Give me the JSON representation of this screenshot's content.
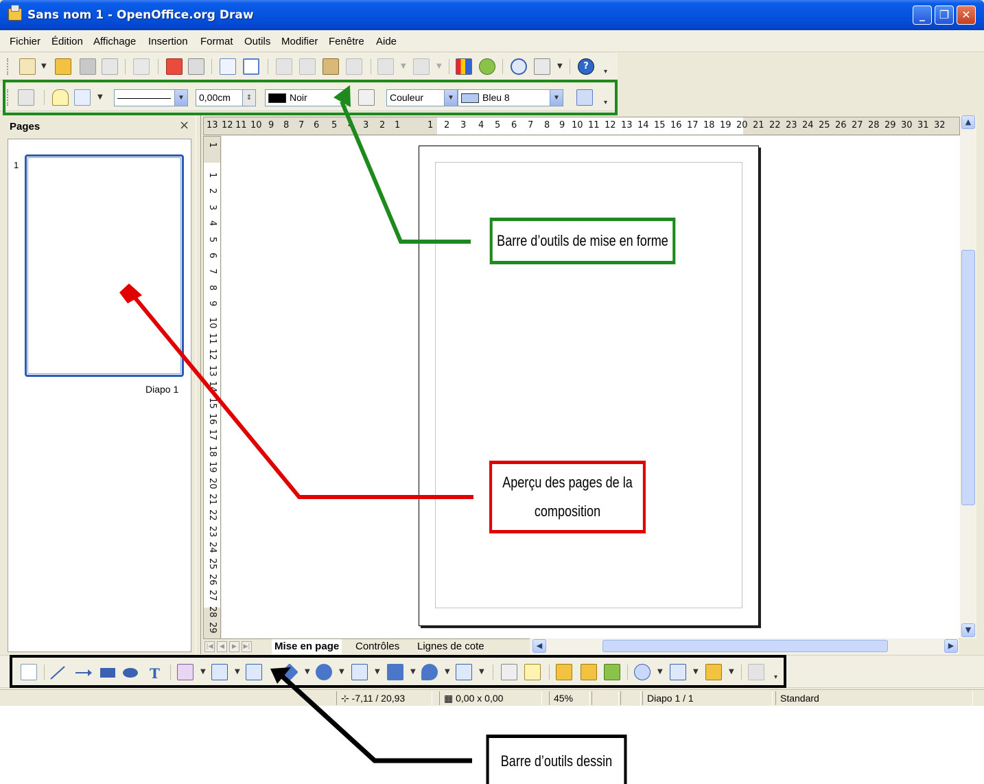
{
  "window": {
    "title": "Sans nom 1 - OpenOffice.org Draw"
  },
  "menu": [
    "Fichier",
    "Édition",
    "Affichage",
    "Insertion",
    "Format",
    "Outils",
    "Modifier",
    "Fenêtre",
    "Aide"
  ],
  "format_toolbar": {
    "line_style": "",
    "line_width": "0,00cm",
    "line_color": {
      "label": "Noir",
      "swatch": "#000000"
    },
    "area_style": "Couleur",
    "area_fill": {
      "label": "Bleu 8",
      "swatch": "#b2cbf0"
    }
  },
  "pages_panel": {
    "title": "Pages",
    "close": "×",
    "items": [
      {
        "number": "1",
        "label": "Diapo 1"
      }
    ]
  },
  "hruler_labels": [
    "13",
    "12",
    "11",
    "10",
    "9",
    "8",
    "7",
    "6",
    "5",
    "4",
    "3",
    "2",
    "1",
    "1",
    "2",
    "3",
    "4",
    "5",
    "6",
    "7",
    "8",
    "9",
    "10",
    "11",
    "12",
    "13",
    "14",
    "15",
    "16",
    "17",
    "18",
    "19",
    "20",
    "21",
    "22",
    "23",
    "24",
    "25",
    "26",
    "27",
    "28",
    "29",
    "30",
    "31",
    "32"
  ],
  "vruler_labels": [
    "1",
    "1",
    "2",
    "3",
    "4",
    "5",
    "6",
    "7",
    "8",
    "9",
    "10",
    "11",
    "12",
    "13",
    "14",
    "15",
    "16",
    "17",
    "18",
    "19",
    "20",
    "21",
    "22",
    "23",
    "24",
    "25",
    "26",
    "27",
    "28",
    "29"
  ],
  "tabs": [
    "Mise en page",
    "Contrôles",
    "Lignes de cote"
  ],
  "status": {
    "position": "-7,11 / 20,93",
    "size": "0,00 x 0,00",
    "zoom": "45%",
    "slide": "Diapo 1 / 1",
    "layout": "Standard"
  },
  "callouts": {
    "format_toolbar": "Barre d’outils de mise en forme",
    "pages_preview": "Aperçu des pages de la composition",
    "drawing_toolbar": "Barre d’outils dessin"
  },
  "colors": {
    "green": "#1e8a1e",
    "red": "#e00000",
    "black": "#000000"
  }
}
